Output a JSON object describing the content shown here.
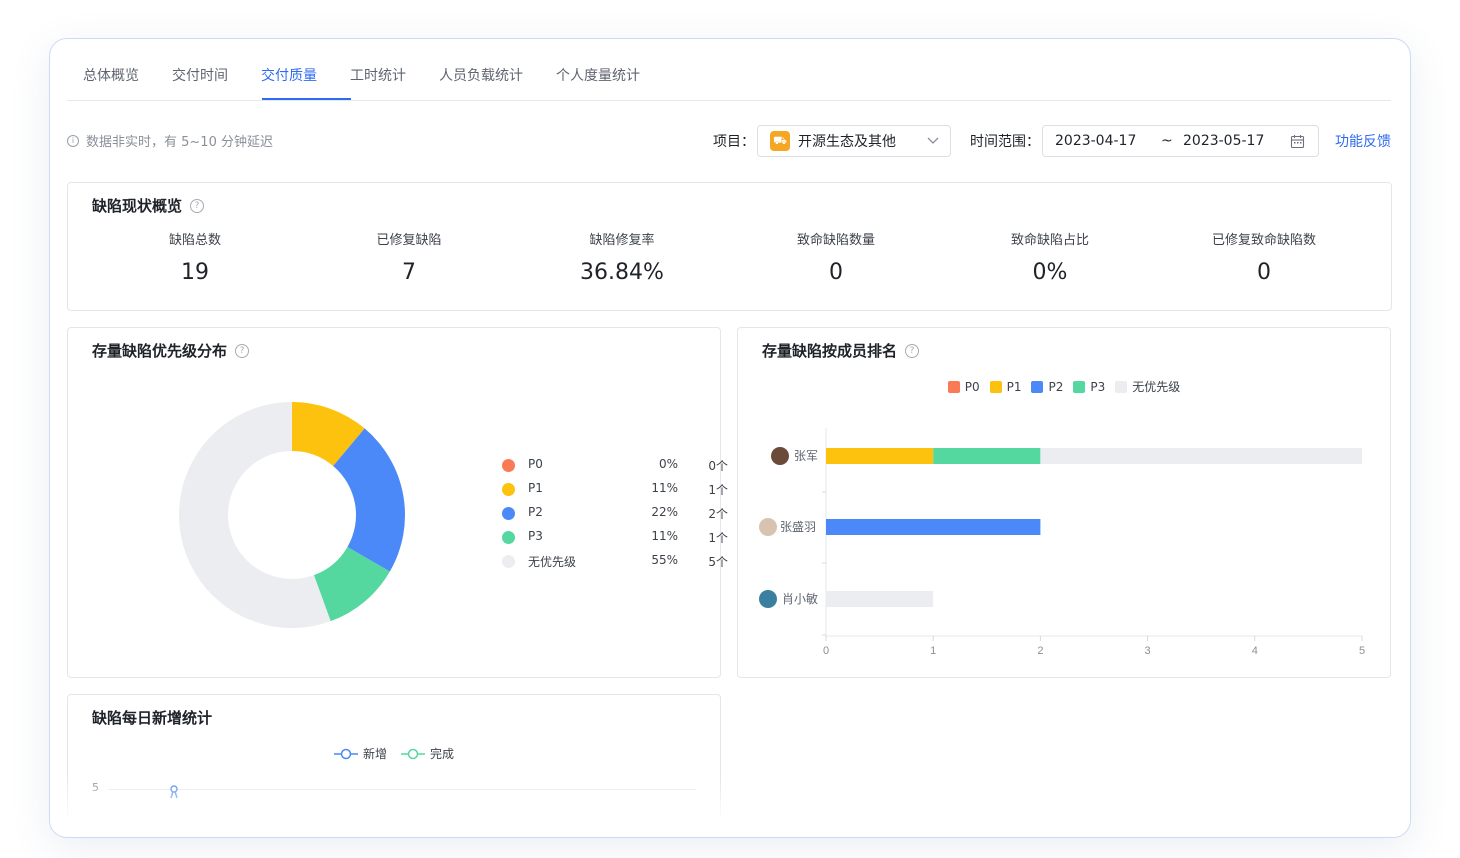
{
  "tabs": [
    {
      "label": "总体概览"
    },
    {
      "label": "交付时间"
    },
    {
      "label": "交付质量",
      "active": true
    },
    {
      "label": "工时统计"
    },
    {
      "label": "人员负载统计"
    },
    {
      "label": "个人度量统计"
    }
  ],
  "toolbar": {
    "notice": "数据非实时，有 5~10 分钟延迟",
    "project_label": "项目：",
    "project_value": "开源生态及其他",
    "project_icon": "project-icon",
    "time_label": "时间范围：",
    "date_start": "2023-04-17",
    "date_sep": "~",
    "date_end": "2023-05-17",
    "feedback": "功能反馈"
  },
  "overview": {
    "title": "缺陷现状概览",
    "stats": [
      {
        "label": "缺陷总数",
        "value": "19"
      },
      {
        "label": "已修复缺陷",
        "value": "7"
      },
      {
        "label": "缺陷修复率",
        "value": "36.84%"
      },
      {
        "label": "致命缺陷数量",
        "value": "0"
      },
      {
        "label": "致命缺陷占比",
        "value": "0%"
      },
      {
        "label": "已修复致命缺陷数",
        "value": "0"
      }
    ]
  },
  "priority_card": {
    "title": "存量缺陷优先级分布",
    "legend": [
      {
        "name": "P0",
        "pct": "0%",
        "count": "0个",
        "color": "#f97a55"
      },
      {
        "name": "P1",
        "pct": "11%",
        "count": "1个",
        "color": "#fcc20d"
      },
      {
        "name": "P2",
        "pct": "22%",
        "count": "2个",
        "color": "#4a89f7"
      },
      {
        "name": "P3",
        "pct": "11%",
        "count": "1个",
        "color": "#55d7a0"
      },
      {
        "name": "无优先级",
        "pct": "55%",
        "count": "5个",
        "color": "#ecedf0"
      }
    ]
  },
  "member_card": {
    "title": "存量缺陷按成员排名",
    "legend": [
      {
        "name": "P0",
        "color": "#f97a55"
      },
      {
        "name": "P1",
        "color": "#fcc20d"
      },
      {
        "name": "P2",
        "color": "#4a89f7"
      },
      {
        "name": "P3",
        "color": "#55d7a0"
      },
      {
        "name": "无优先级",
        "color": "#ecedf0"
      }
    ],
    "members": [
      "张军",
      "张盛羽",
      "肖小敏"
    ]
  },
  "daily_card": {
    "title": "缺陷每日新增统计",
    "legend": [
      {
        "name": "新增",
        "color": "#4a89f7"
      },
      {
        "name": "完成",
        "color": "#55d7a0"
      }
    ],
    "y_tick_top": "5"
  },
  "chart_data": [
    {
      "type": "pie",
      "title": "存量缺陷优先级分布",
      "labels": [
        "P0",
        "P1",
        "P2",
        "P3",
        "无优先级"
      ],
      "values": [
        0,
        1,
        2,
        1,
        5
      ],
      "percent": [
        0,
        11,
        22,
        11,
        55
      ],
      "donut": true,
      "legend": "right",
      "colors": [
        "#f97a55",
        "#fcc20d",
        "#4a89f7",
        "#55d7a0",
        "#ecedf0"
      ]
    },
    {
      "type": "bar",
      "orientation": "horizontal",
      "stacked": true,
      "title": "存量缺陷按成员排名",
      "categories": [
        "张军",
        "张盛羽",
        "肖小敏"
      ],
      "series": [
        {
          "name": "P0",
          "values": [
            0,
            0,
            0
          ]
        },
        {
          "name": "P1",
          "values": [
            1,
            0,
            0
          ]
        },
        {
          "name": "P2",
          "values": [
            0,
            2,
            0
          ]
        },
        {
          "name": "P3",
          "values": [
            1,
            0,
            0
          ]
        },
        {
          "name": "无优先级",
          "values": [
            3,
            0,
            1
          ]
        }
      ],
      "xlim": [
        0,
        5
      ],
      "xticks": [
        "0",
        "1",
        "2",
        "3",
        "4",
        "5"
      ],
      "legend": "top"
    },
    {
      "type": "line",
      "title": "缺陷每日新增统计",
      "series": [
        {
          "name": "新增",
          "values": []
        },
        {
          "name": "完成",
          "values": []
        }
      ],
      "yticks": [
        "5"
      ],
      "legend": "top"
    }
  ]
}
